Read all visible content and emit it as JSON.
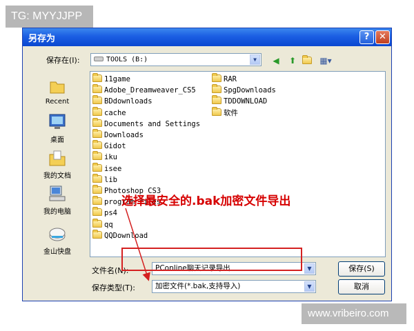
{
  "watermarks": {
    "top_left": "TG: MYYJJPP",
    "bottom_right": "www.vribeiro.com"
  },
  "dialog": {
    "title": "另存为",
    "help_button": "?",
    "close_button": "✕",
    "save_in_label": "保存在(I):",
    "save_in_value": "TOOLS (B:)",
    "places": [
      {
        "label": "Recent",
        "icon": "recent-icon"
      },
      {
        "label": "桌面",
        "icon": "desktop-icon"
      },
      {
        "label": "我的文档",
        "icon": "my-documents-icon"
      },
      {
        "label": "我的电脑",
        "icon": "my-computer-icon"
      },
      {
        "label": "金山快盘",
        "icon": "kuaipan-icon"
      }
    ],
    "folders_col1": [
      "11game",
      "Adobe_Dreamweaver_CS5",
      "BDdownloads",
      "cache",
      "Documents and Settings",
      "Downloads",
      "Gidot",
      "iku",
      "isee",
      "lib",
      "Photoshop CS3",
      "program files",
      "ps4",
      "qq",
      "QQDownload"
    ],
    "folders_col2": [
      "RAR",
      "SpgDownloads",
      "TDDOWNLOAD",
      "软件"
    ],
    "filename_label": "文件名(N):",
    "filename_value": "PConline聊天记录导出",
    "filetype_label": "保存类型(T):",
    "filetype_value": "加密文件(*.bak,支持导入)",
    "save_button": "保存(S)",
    "cancel_button": "取消"
  },
  "annotation": "选择最安全的.bak加密文件导出",
  "colors": {
    "annotation": "#d60000",
    "titlebar": "#0a47d0"
  }
}
